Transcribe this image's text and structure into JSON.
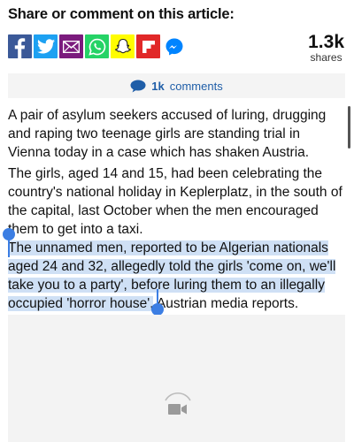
{
  "share": {
    "heading": "Share or comment on this article:",
    "buttons": [
      {
        "name": "facebook",
        "icon": "facebook-icon",
        "color": "#3b5998"
      },
      {
        "name": "twitter",
        "icon": "twitter-icon",
        "color": "#1da1f2"
      },
      {
        "name": "email",
        "icon": "email-icon",
        "color": "#7b1b7d"
      },
      {
        "name": "whatsapp",
        "icon": "whatsapp-icon",
        "color": "#25d366"
      },
      {
        "name": "snapchat",
        "icon": "snapchat-icon",
        "color": "#fffc00"
      },
      {
        "name": "flipboard",
        "icon": "flipboard-icon",
        "color": "#e12828"
      },
      {
        "name": "messenger",
        "icon": "messenger-icon",
        "color": "#0084ff"
      }
    ],
    "count": "1.3k",
    "count_label": "shares"
  },
  "comments": {
    "count": "1k",
    "label": "comments",
    "icon": "comment-bubble-icon",
    "color": "#1f5ea8"
  },
  "article": {
    "p1": "A pair of asylum seekers accused of luring, drugging and raping two teenage girls are standing trial in Vienna today in a case which has shaken Austria.",
    "p2": "The girls, aged 14 and 15, had been celebrating the country's national holiday in Keplerplatz, in the south of the capital, last October when the men encouraged them to get into a taxi.",
    "p3_selected": "The unnamed men, reported to be Algerian nationals aged 24 and 32, allegedly told the girls 'come on, we'll take you to a party', before luring them to an illegally occupied 'horror house',",
    "p3_rest": " Austrian media reports."
  },
  "selection": {
    "color": "#cfe0f5",
    "handle_color": "#3c7ee3"
  },
  "media": {
    "icon": "video-camera-icon",
    "loading_icon": "loading-spinner-icon"
  }
}
